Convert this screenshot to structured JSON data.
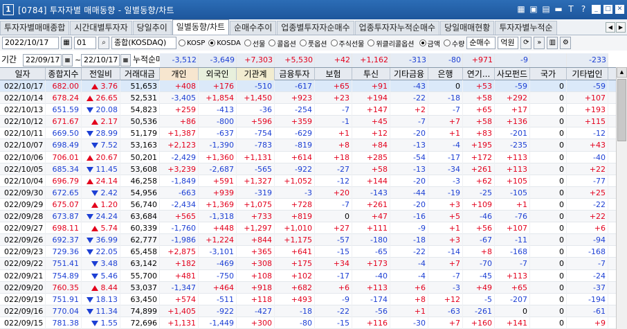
{
  "window": {
    "num": "1",
    "title": "[0784] 투자자별 매매동향 - 일별동향/차트"
  },
  "title_icons": [
    "▦",
    "▣",
    "▤",
    "▬",
    "T",
    "?",
    "_",
    "□",
    "✕"
  ],
  "tabs": [
    "투자자별매매종합",
    "시간대별투자자",
    "당일추이",
    "일별동향/차트",
    "순매수추이",
    "업종별투자자순매수",
    "업종투자자누적순매수",
    "당일매매현황",
    "투자자별누적순"
  ],
  "active_tab": 3,
  "toolbar": {
    "date": "2022/10/17",
    "market_code": "01",
    "market_name": "종합(KOSDAQ)",
    "radios": [
      {
        "label": "KOSP",
        "on": false
      },
      {
        "label": "KOSDA",
        "on": true
      },
      {
        "label": "선물",
        "on": false
      },
      {
        "label": "콜옵션",
        "on": false
      },
      {
        "label": "풋옵션",
        "on": false
      },
      {
        "label": "주식선물",
        "on": false
      },
      {
        "label": "위클리콜옵션",
        "on": false
      }
    ],
    "radios2": [
      {
        "label": "금액",
        "on": true
      },
      {
        "label": "수량",
        "on": false
      }
    ],
    "order": "순매수",
    "unit": "억원",
    "btn_query": "조회",
    "btn_next": "다음"
  },
  "sumbar": {
    "period_label": "기간",
    "from": "22/09/17",
    "to": "22/10/17",
    "sum_label": "누적순매수",
    "values": [
      "-3,512",
      "-3,649",
      "+7,303",
      "+5,530",
      "+42",
      "+1,162",
      "-313",
      "-80",
      "+971",
      "-9",
      "",
      "-233"
    ]
  },
  "columns": [
    "일자",
    "종합지수",
    "전일비",
    "거래대금",
    "개인",
    "외국인",
    "기관계",
    "금융투자",
    "보험",
    "투신",
    "기타금융",
    "은행",
    "연기...",
    "사모펀드",
    "국가",
    "기타법인"
  ],
  "rows": [
    [
      "022/10/17",
      "682.00",
      "up",
      "3.76",
      "51,653",
      "+408",
      "+176",
      "-510",
      "-617",
      "+65",
      "+91",
      "-43",
      "0",
      "+53",
      "-59",
      "0",
      "-59"
    ],
    [
      "022/10/14",
      "678.24",
      "up",
      "26.65",
      "52,531",
      "-3,405",
      "+1,854",
      "+1,450",
      "+923",
      "+23",
      "+194",
      "-22",
      "-18",
      "+58",
      "+292",
      "0",
      "+107"
    ],
    [
      "022/10/13",
      "651.59",
      "dn",
      "20.08",
      "54,823",
      "+259",
      "-413",
      "-36",
      "-254",
      "-7",
      "+147",
      "+2",
      "-7",
      "+65",
      "+17",
      "0",
      "+193"
    ],
    [
      "022/10/12",
      "671.67",
      "up",
      "2.17",
      "50,536",
      "+86",
      "-800",
      "+596",
      "+359",
      "-1",
      "+45",
      "-7",
      "+7",
      "+58",
      "+136",
      "0",
      "+115"
    ],
    [
      "022/10/11",
      "669.50",
      "dn",
      "28.99",
      "51,179",
      "+1,387",
      "-637",
      "-754",
      "-629",
      "+1",
      "+12",
      "-20",
      "+1",
      "+83",
      "-201",
      "0",
      "-12"
    ],
    [
      "022/10/07",
      "698.49",
      "dn",
      "7.52",
      "53,163",
      "+2,123",
      "-1,390",
      "-783",
      "-819",
      "+8",
      "+84",
      "-13",
      "-4",
      "+195",
      "-235",
      "0",
      "+43"
    ],
    [
      "022/10/06",
      "706.01",
      "up",
      "20.67",
      "50,201",
      "-2,429",
      "+1,360",
      "+1,131",
      "+614",
      "+18",
      "+285",
      "-54",
      "-17",
      "+172",
      "+113",
      "0",
      "-40"
    ],
    [
      "022/10/05",
      "685.34",
      "dn",
      "11.45",
      "53,608",
      "+3,239",
      "-2,687",
      "-565",
      "-922",
      "-27",
      "+58",
      "-13",
      "-34",
      "+261",
      "+113",
      "0",
      "+22"
    ],
    [
      "022/10/04",
      "696.79",
      "up",
      "24.14",
      "46,258",
      "-1,849",
      "+591",
      "+1,327",
      "+1,052",
      "-12",
      "+144",
      "-20",
      "-3",
      "+62",
      "+105",
      "0",
      "-77"
    ],
    [
      "022/09/30",
      "672.65",
      "dn",
      "2.42",
      "54,956",
      "-663",
      "+939",
      "-319",
      "-3",
      "+20",
      "-143",
      "-44",
      "-19",
      "-25",
      "-105",
      "0",
      "+25"
    ],
    [
      "022/09/29",
      "675.07",
      "up",
      "1.20",
      "56,740",
      "-2,434",
      "+1,369",
      "+1,075",
      "+728",
      "-7",
      "+261",
      "-20",
      "+3",
      "+109",
      "+1",
      "0",
      "-22"
    ],
    [
      "022/09/28",
      "673.87",
      "dn",
      "24.24",
      "63,684",
      "+565",
      "-1,318",
      "+733",
      "+819",
      "0",
      "+47",
      "-16",
      "+5",
      "-46",
      "-76",
      "0",
      "+22"
    ],
    [
      "022/09/27",
      "698.11",
      "up",
      "5.74",
      "60,339",
      "-1,760",
      "+448",
      "+1,297",
      "+1,010",
      "+27",
      "+111",
      "-9",
      "+1",
      "+56",
      "+107",
      "0",
      "+6"
    ],
    [
      "022/09/26",
      "692.37",
      "dn",
      "36.99",
      "62,777",
      "-1,986",
      "+1,224",
      "+844",
      "+1,175",
      "-57",
      "-180",
      "-18",
      "+3",
      "-67",
      "-11",
      "0",
      "-94"
    ],
    [
      "022/09/23",
      "729.36",
      "dn",
      "22.05",
      "65,458",
      "+2,875",
      "-3,101",
      "+365",
      "+641",
      "-15",
      "-65",
      "-22",
      "-14",
      "+8",
      "-168",
      "0",
      "-168"
    ],
    [
      "022/09/22",
      "751.41",
      "dn",
      "3.48",
      "63,142",
      "+182",
      "-469",
      "+308",
      "+175",
      "+34",
      "+173",
      "-4",
      "+7",
      "-70",
      "-7",
      "0",
      "-7"
    ],
    [
      "022/09/21",
      "754.89",
      "dn",
      "5.46",
      "55,700",
      "+481",
      "-750",
      "+108",
      "+102",
      "-17",
      "-40",
      "-4",
      "-7",
      "-45",
      "+113",
      "0",
      "-24"
    ],
    [
      "022/09/20",
      "760.35",
      "up",
      "8.44",
      "53,037",
      "-1,347",
      "+464",
      "+918",
      "+682",
      "+6",
      "+113",
      "+6",
      "-3",
      "+49",
      "+65",
      "0",
      "-37"
    ],
    [
      "022/09/19",
      "751.91",
      "dn",
      "18.13",
      "63,450",
      "+574",
      "-511",
      "+118",
      "+493",
      "-9",
      "-174",
      "+8",
      "+12",
      "-5",
      "-207",
      "0",
      "-194"
    ],
    [
      "022/09/16",
      "770.04",
      "dn",
      "11.34",
      "74,899",
      "+1,405",
      "-922",
      "-427",
      "-18",
      "-22",
      "-56",
      "+1",
      "-63",
      "-261",
      "0",
      "0",
      "-61"
    ],
    [
      "022/09/15",
      "781.38",
      "dn",
      "1.55",
      "72,696",
      "+1,131",
      "-1,449",
      "+300",
      "-80",
      "-15",
      "+116",
      "-30",
      "+7",
      "+160",
      "+141",
      "0",
      "+9"
    ]
  ]
}
